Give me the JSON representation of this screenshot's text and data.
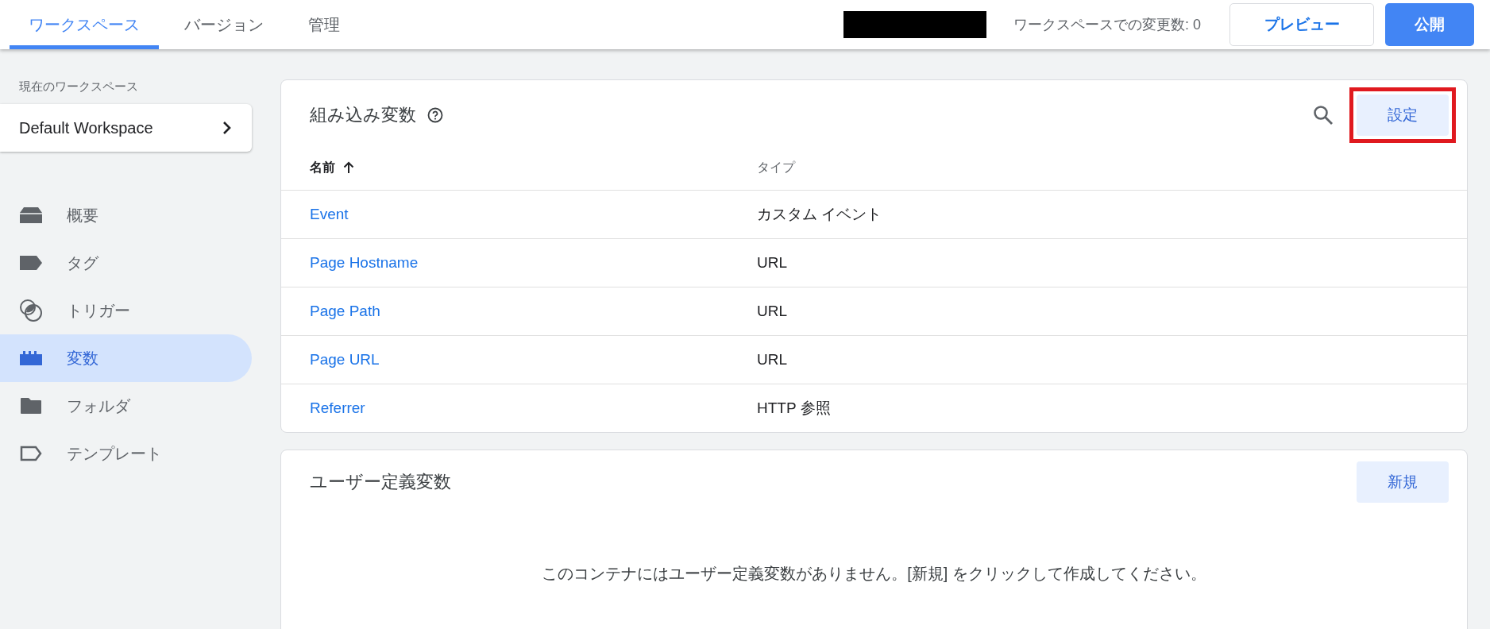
{
  "top_bar": {
    "tabs": [
      {
        "label": "ワークスペース",
        "selected": true
      },
      {
        "label": "バージョン",
        "selected": false
      },
      {
        "label": "管理",
        "selected": false
      }
    ],
    "redacted": true,
    "changes": "ワークスペースでの変更数: 0",
    "preview_button": "プレビュー",
    "publish_button": "公開"
  },
  "sidebar": {
    "workspace_label": "現在のワークスペース",
    "workspace": "Default Workspace",
    "items": [
      {
        "kind": "overview",
        "label": "概要",
        "selected": false
      },
      {
        "kind": "tag",
        "label": "タグ",
        "selected": false
      },
      {
        "kind": "trigger",
        "label": "トリガー",
        "selected": false
      },
      {
        "kind": "variable",
        "label": "変数",
        "selected": true
      },
      {
        "kind": "folder",
        "label": "フォルダ",
        "selected": false
      },
      {
        "kind": "template",
        "label": "テンプレート",
        "selected": false
      }
    ]
  },
  "builtin_card": {
    "title": "組み込み変数",
    "settings_button": "設定",
    "highlighted": true,
    "columns": [
      "名前",
      "タイプ"
    ],
    "rows": [
      {
        "name": "Event",
        "type": "カスタム イベント"
      },
      {
        "name": "Page Hostname",
        "type": "URL"
      },
      {
        "name": "Page Path",
        "type": "URL"
      },
      {
        "name": "Page URL",
        "type": "URL"
      },
      {
        "name": "Referrer",
        "type": "HTTP 参照"
      }
    ]
  },
  "user_card": {
    "title": "ユーザー定義変数",
    "new_button": "新規",
    "empty_message": "このコンテナにはユーザー定義変数がありません。[新規] をクリックして作成してください。"
  }
}
